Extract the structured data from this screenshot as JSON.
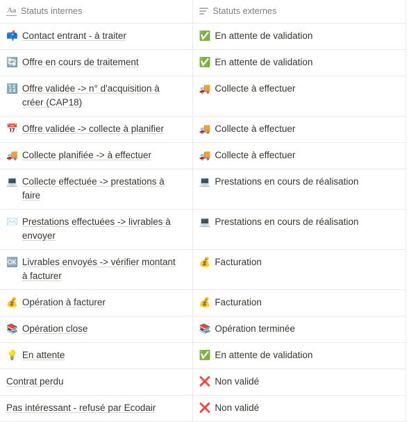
{
  "table": {
    "columns": [
      {
        "label": "Statuts internes",
        "icon": "text-property-icon",
        "type": "title"
      },
      {
        "label": "Statuts externes",
        "icon": "select-property-icon",
        "type": "select"
      }
    ],
    "rows": [
      {
        "internal": {
          "emoji": "📫",
          "emoji_name": "mailbox-icon",
          "text": "Contact entrant - à traiter"
        },
        "external": {
          "emoji": "✅",
          "emoji_name": "check-mark-button-icon",
          "text": "En attente de validation"
        }
      },
      {
        "internal": {
          "emoji": "🔄",
          "emoji_name": "counterclockwise-arrows-icon",
          "text": "Offre en cours de traitement"
        },
        "external": {
          "emoji": "✅",
          "emoji_name": "check-mark-button-icon",
          "text": "En attente de validation"
        }
      },
      {
        "internal": {
          "emoji": "🔢",
          "emoji_name": "input-numbers-icon",
          "text": "Offre validée -> n° d'acquisition à créer (CAP18)"
        },
        "external": {
          "emoji": "🚚",
          "emoji_name": "delivery-truck-icon",
          "text": "Collecte à effectuer"
        }
      },
      {
        "internal": {
          "emoji": "📅",
          "emoji_name": "calendar-icon",
          "text": "Offre validée -> collecte à planifier"
        },
        "external": {
          "emoji": "🚚",
          "emoji_name": "delivery-truck-icon",
          "text": "Collecte à effectuer"
        }
      },
      {
        "internal": {
          "emoji": "🚚",
          "emoji_name": "delivery-truck-icon",
          "text": "Collecte planifiée -> à effectuer"
        },
        "external": {
          "emoji": "🚚",
          "emoji_name": "delivery-truck-icon",
          "text": "Collecte à effectuer"
        }
      },
      {
        "internal": {
          "emoji": "💻",
          "emoji_name": "laptop-icon",
          "text": "Collecte effectuée -> prestations à faire"
        },
        "external": {
          "emoji": "💻",
          "emoji_name": "laptop-icon",
          "text": "Prestations en cours de réalisation"
        }
      },
      {
        "internal": {
          "emoji": "✉️",
          "emoji_name": "envelope-icon",
          "text": "Prestations effectuées -> livrables à envoyer"
        },
        "external": {
          "emoji": "💻",
          "emoji_name": "laptop-icon",
          "text": "Prestations en cours de réalisation"
        }
      },
      {
        "internal": {
          "emoji": "🆗",
          "emoji_name": "ok-button-icon",
          "text": "Livrables envoyés -> vérifier montant à facturer"
        },
        "external": {
          "emoji": "💰",
          "emoji_name": "money-bag-icon",
          "text": "Facturation"
        }
      },
      {
        "internal": {
          "emoji": "💰",
          "emoji_name": "money-bag-icon",
          "text": "Opération à facturer"
        },
        "external": {
          "emoji": "💰",
          "emoji_name": "money-bag-icon",
          "text": "Facturation"
        }
      },
      {
        "internal": {
          "emoji": "📚",
          "emoji_name": "books-icon",
          "text": "Opération close"
        },
        "external": {
          "emoji": "📚",
          "emoji_name": "books-icon",
          "text": "Opération terminée"
        }
      },
      {
        "internal": {
          "emoji": "💡",
          "emoji_name": "light-bulb-icon",
          "text": "En attente"
        },
        "external": {
          "emoji": "✅",
          "emoji_name": "check-mark-button-icon",
          "text": "En attente de validation"
        }
      },
      {
        "internal": {
          "emoji": "",
          "emoji_name": "no-icon",
          "text": "Contrat perdu"
        },
        "external": {
          "emoji": "❌",
          "emoji_name": "cross-mark-icon",
          "text": "Non validé"
        }
      },
      {
        "internal": {
          "emoji": "",
          "emoji_name": "no-icon",
          "text": "Pas intéressant - refusé par Ecodair"
        },
        "external": {
          "emoji": "❌",
          "emoji_name": "cross-mark-icon",
          "text": "Non validé"
        }
      }
    ]
  },
  "colors": {
    "text": "#37352f",
    "header_text": "#7d7c78",
    "border": "#e9e9e7",
    "underline": "#d8d7d4",
    "check_green": "#3fa34a",
    "cross_red": "#e03e3e"
  }
}
